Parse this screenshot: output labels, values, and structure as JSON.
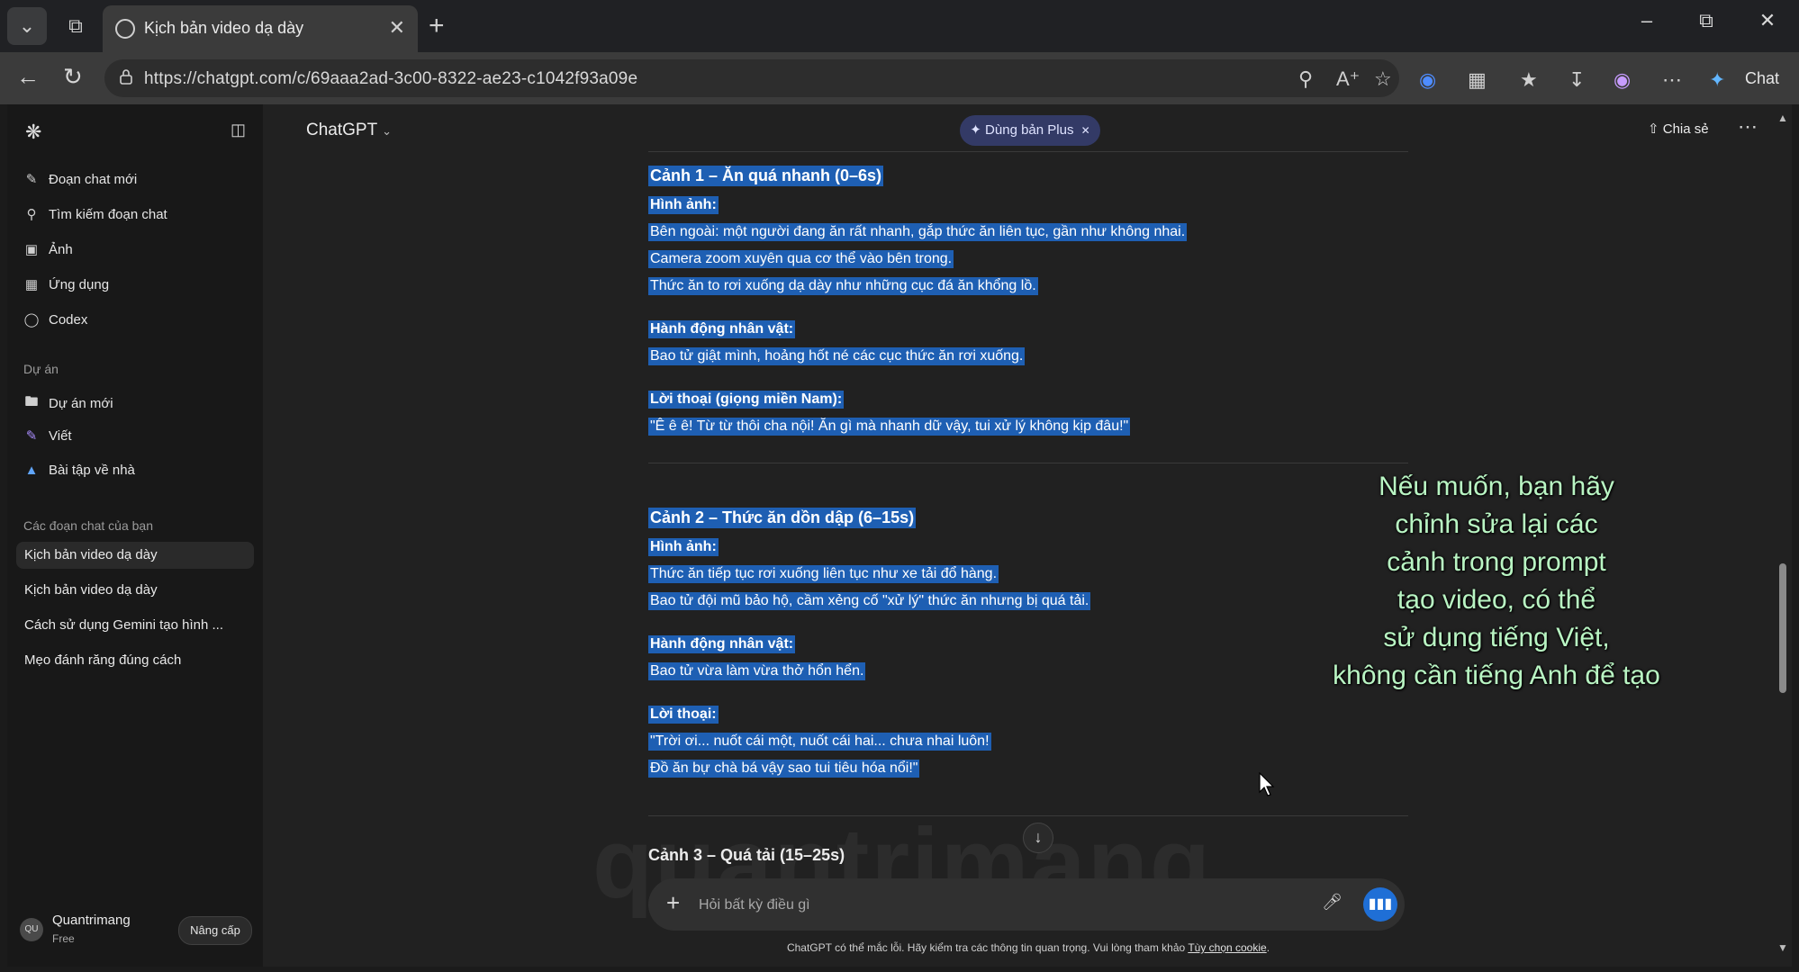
{
  "browser": {
    "tab_title": "Kịch bản video dạ dày",
    "url": "https://chatgpt.com/c/69aaa2ad-3c00-8322-ae23-c1042f93a09e",
    "copilot_label": "Chat"
  },
  "sidebar": {
    "actions": [
      {
        "label": "Đoạn chat mới",
        "icon": "edit-icon"
      },
      {
        "label": "Tìm kiếm đoạn chat",
        "icon": "search-icon"
      },
      {
        "label": "Ảnh",
        "icon": "image-icon"
      },
      {
        "label": "Ứng dụng",
        "icon": "apps-icon"
      },
      {
        "label": "Codex",
        "icon": "codex-icon"
      }
    ],
    "projects_heading": "Dự án",
    "projects": [
      {
        "label": "Dự án mới",
        "icon": "new-folder-icon"
      },
      {
        "label": "Viết",
        "icon": "pen-icon"
      },
      {
        "label": "Bài tập về nhà",
        "icon": "graduation-cap-icon"
      }
    ],
    "chats_heading": "Các đoạn chat của bạn",
    "chats": [
      "Kịch bản video dạ dày",
      "Kịch bản video dạ dày",
      "Cách sử dụng Gemini tạo hình ...",
      "Mẹo đánh răng đúng cách"
    ],
    "user": {
      "initials": "QU",
      "name": "Quantrimang",
      "plan": "Free",
      "upgrade_label": "Nâng cấp"
    }
  },
  "header": {
    "model": "ChatGPT",
    "plus_pill": "Dùng bản Plus",
    "share_label": "Chia sẻ"
  },
  "conversation": {
    "scene1": {
      "title": "Cảnh 1 – Ăn quá nhanh (0–6s)",
      "image_label": "Hình ảnh:",
      "image_lines": [
        "Bên ngoài: một người đang ăn rất nhanh, gắp thức ăn liên tục, gần như không nhai.",
        "Camera zoom xuyên qua cơ thể vào bên trong.",
        "Thức ăn to rơi xuống dạ dày như những cục đá ăn khổng lồ."
      ],
      "action_label": "Hành động nhân vật:",
      "action_line": "Bao tử giật mình, hoảng hốt né các cục thức ăn rơi xuống.",
      "dialogue_label": "Lời thoại (giọng miền Nam):",
      "dialogue_line": "\"Ê ê ê! Từ từ thôi cha nội! Ăn gì mà nhanh dữ vậy, tui xử lý không kịp đâu!\""
    },
    "scene2": {
      "title": "Cảnh 2 – Thức ăn dồn dập (6–15s)",
      "image_label": "Hình ảnh:",
      "image_lines": [
        "Thức ăn tiếp tục rơi xuống liên tục như xe tải đổ hàng.",
        "Bao tử đội mũ bảo hộ, cầm xẻng cố \"xử lý\" thức ăn nhưng bị quá tải."
      ],
      "action_label": "Hành động nhân vật:",
      "action_line": "Bao tử vừa làm vừa thở hổn hển.",
      "dialogue_label": "Lời thoại:",
      "dialogue_lines": [
        "\"Trời ơi... nuốt cái một, nuốt cái hai... chưa nhai luôn!",
        "Đồ ăn bự chà bá vậy sao tui tiêu hóa nổi!\""
      ]
    },
    "scene3_title": "Cảnh 3 – Quá tải (15–25s)"
  },
  "composer": {
    "placeholder": "Hỏi bất kỳ điều gì"
  },
  "disclaimer": {
    "text": "ChatGPT có thể mắc lỗi. Hãy kiểm tra các thông tin quan trọng. Vui lòng tham khảo ",
    "link": "Tùy chọn cookie",
    "end": "."
  },
  "caption_lines": [
    "Nếu muốn, bạn hãy",
    "chỉnh sửa lại các",
    "cảnh trong prompt",
    "tạo video, có thể",
    "sử dụng tiếng Việt,",
    "không cần tiếng Anh để tạo"
  ],
  "watermark": "quantrimang",
  "colors": {
    "selection_highlight": "#1e5fb3",
    "caption_text": "#b9f5c3",
    "voice_button": "#1f6fd6",
    "plus_pill": "#333a66"
  }
}
